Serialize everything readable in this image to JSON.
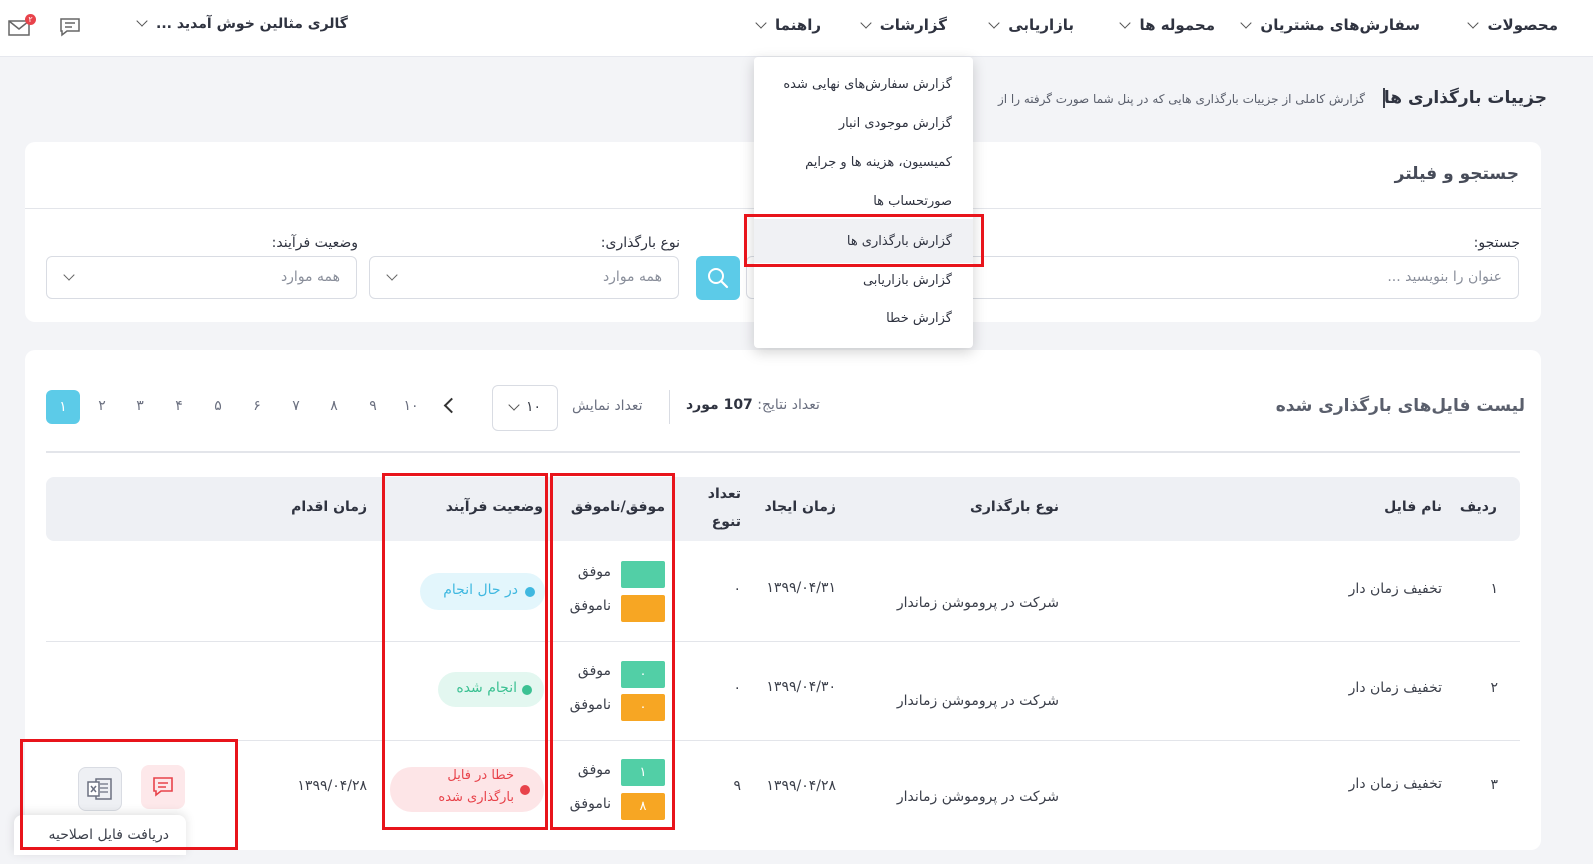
{
  "nav": {
    "items": [
      "محصولات",
      "سفارش‌های مشتریان",
      "محموله ها",
      "بازاریابی",
      "گزارشات",
      "راهنما"
    ],
    "greeting": "گالری مثالین خوش آمدید ...",
    "notification_count": "۲"
  },
  "header": {
    "title": "جزییات بارگذاری ها",
    "description": "گزارش کاملی از جزییات بارگذاری هایی که در پنل شما صورت گرفته را از"
  },
  "reports_menu": {
    "items": [
      "گزارش سفارش‌های نهایی شده",
      "گزارش موجودی انبار",
      "کمیسیون، هزینه ها و جرایم",
      "صورتحساب ها",
      "گزارش بارگذاری ها",
      "گزارش بازاریابی",
      "گزارش خطا"
    ],
    "active_index": 4
  },
  "filter": {
    "title": "جستجو و فیلتر",
    "search_label": "جستجو:",
    "search_placeholder": "عنوان را بنویسید ...",
    "upload_type_label": "نوع بارگذاری:",
    "upload_type_value": "همه موارد",
    "status_label": "وضعیت فرآیند:",
    "status_value": "همه موارد"
  },
  "list": {
    "title": "لیست فایل‌های بارگذاری شده",
    "results_label": "تعداد نتایج:",
    "results_value": "107 مورد",
    "show_label": "تعداد نمایش",
    "per_page": "۱۰",
    "pages": [
      "۱",
      "۲",
      "۳",
      "۴",
      "۵",
      "۶",
      "۷",
      "۸",
      "۹",
      "۱۰"
    ],
    "active_page": "۱"
  },
  "table": {
    "headers": {
      "row": "ردیف",
      "file_name": "نام فایل",
      "upload_type": "نوع بارگذاری",
      "created": "زمان ایجاد",
      "variety_line1": "تعداد",
      "variety_line2": "تنوع",
      "success_fail": "موفق/ناموفق",
      "status": "وضعیت فرآیند",
      "action_time": "زمان اقدام"
    },
    "success_label": "موفق",
    "fail_label": "ناموفق",
    "rows": [
      {
        "index": "۱",
        "file_name": "تخفیف زمان دار",
        "upload_type": "شرکت در پروموشن زماندار",
        "created": "۱۳۹۹/۰۴/۳۱",
        "variety": "۰",
        "success": "",
        "fail": "",
        "status": "در حال انجام",
        "action_time": ""
      },
      {
        "index": "۲",
        "file_name": "تخفیف زمان دار",
        "upload_type": "شرکت در پروموشن زماندار",
        "created": "۱۳۹۹/۰۴/۳۰",
        "variety": "۰",
        "success": "۰",
        "fail": "۰",
        "status": "انجام شده",
        "action_time": ""
      },
      {
        "index": "۳",
        "file_name": "تخفیف زمان دار",
        "upload_type": "شرکت در پروموشن زماندار",
        "created": "۱۳۹۹/۰۴/۲۸",
        "variety": "۹",
        "success": "۱",
        "fail": "۸",
        "status_line1": "خطا در فایل",
        "status_line2": "بارگذاری شده",
        "action_time": "۱۳۹۹/۰۴/۲۸"
      }
    ]
  },
  "tooltip": {
    "text": "دریافت فایل اصلاحیه"
  },
  "colors": {
    "accent": "#5ccbe8",
    "success": "#52cfa6",
    "fail": "#f7a623",
    "highlight_frame": "#e8141b",
    "status_in_progress": "#3fb8e0",
    "status_done": "#3cc193",
    "status_error": "#e8434b"
  },
  "icons": [
    "mail-icon",
    "chat-icon",
    "chevron-down-icon",
    "search-icon",
    "chevron-left-icon",
    "comment-icon",
    "excel-icon"
  ]
}
